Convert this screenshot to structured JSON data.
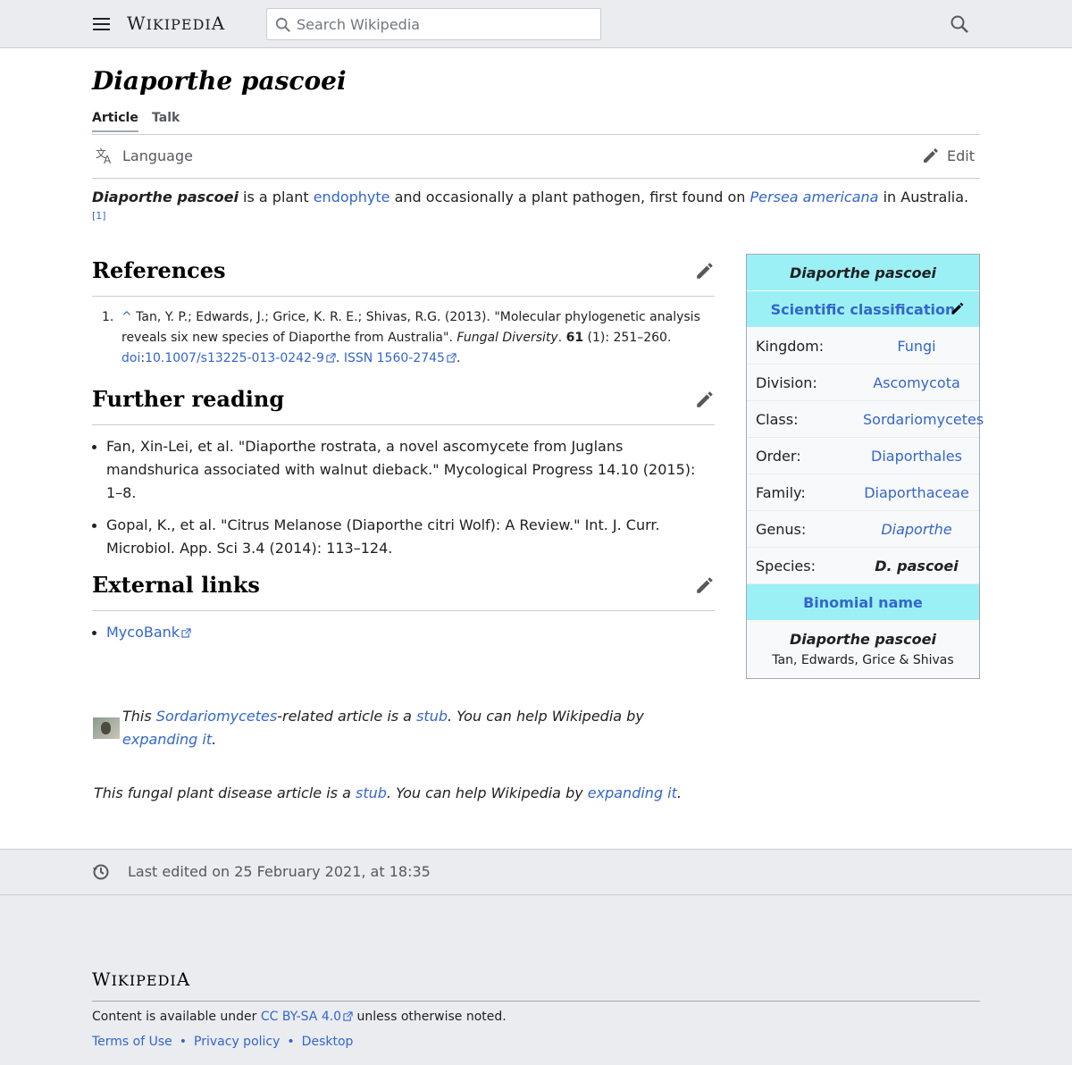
{
  "header": {
    "wordmark_first": "W",
    "wordmark_rest": "IKIPEDI",
    "wordmark_last": "A",
    "search_placeholder": "Search Wikipedia"
  },
  "page": {
    "title": "Diaporthe pascoei",
    "tabs": [
      "Article",
      "Talk"
    ],
    "language_label": "Language",
    "edit_label": "Edit"
  },
  "lead": {
    "bold_name": "Diaporthe pascoei",
    "t1": " is a plant ",
    "link1": "endophyte",
    "t2": " and occasionally a plant pathogen, first found on ",
    "link2": "Persea americana",
    "t3": " in Australia.",
    "cite": "[1]"
  },
  "sections": {
    "references": "References",
    "further_reading": "Further reading",
    "external_links": "External links"
  },
  "references": [
    {
      "num": "1.",
      "caret": "^",
      "authors": " Tan, Y. P.; Edwards, J.; Grice, K. R. E.; Shivas, R.G. (2013). \"Molecular phylogenetic analysis reveals six new species of Diaporthe from Australia\". ",
      "journal": "Fungal Diversity",
      "sep": ". ",
      "volume": "61",
      "pages": " (1): 251–260.",
      "doi_label": "doi",
      "doi_colon": ":",
      "doi_value": "10.1007/s13225-013-0242-9",
      "dot": ". ",
      "issn_label": "ISSN",
      "issn_value": " 1560-2745",
      "end": "."
    }
  ],
  "further_reading": [
    "Fan, Xin-Lei, et al. \"Diaporthe rostrata, a novel ascomycete from Juglans mandshurica associated with walnut dieback.\" Mycological Progress 14.10 (2015): 1–8.",
    "Gopal, K., et al. \"Citrus Melanose (Diaporthe citri Wolf): A Review.\" Int. J. Curr. Microbiol. App. Sci 3.4 (2014): 113–124."
  ],
  "external_links": [
    "MycoBank"
  ],
  "infobox": {
    "title": "Diaporthe pascoei",
    "classification_header": "Scientific classification",
    "rows": [
      {
        "label": "Kingdom:",
        "value": "Fungi"
      },
      {
        "label": "Division:",
        "value": "Ascomycota"
      },
      {
        "label": "Class:",
        "value": "Sordariomycetes"
      },
      {
        "label": "Order:",
        "value": "Diaporthales"
      },
      {
        "label": "Family:",
        "value": "Diaporthaceae"
      },
      {
        "label": "Genus:",
        "value": "Diaporthe"
      },
      {
        "label": "Species:",
        "value": "D. pascoei"
      }
    ],
    "binomial_header": "Binomial name",
    "binomial": "Diaporthe pascoei",
    "authority": "Tan, Edwards, Grice & Shivas"
  },
  "stubs": {
    "s1_a": "This ",
    "s1_link": "Sordariomycetes",
    "s1_b": "-related article is a ",
    "s1_stub": "stub",
    "s1_c": ". You can help Wikipedia by ",
    "s1_expand": "expanding it",
    "s1_d": ".",
    "s2_a": "This fungal plant disease article is a ",
    "s2_stub": "stub",
    "s2_b": ". You can help Wikipedia by ",
    "s2_expand": "expanding it",
    "s2_c": "."
  },
  "footer": {
    "last_edited": "Last edited on 25 February 2021, at 18:35",
    "license_pre": "Content is available under ",
    "license_link": "CC BY-SA 4.0",
    "license_post": " unless otherwise noted.",
    "links": [
      "Terms of Use",
      "Privacy policy",
      "Desktop"
    ],
    "sep": "•"
  },
  "colors": {
    "link": "#3366cc",
    "infobox_header": "#9bf0f5",
    "chrome_bg": "#eaecf0"
  }
}
